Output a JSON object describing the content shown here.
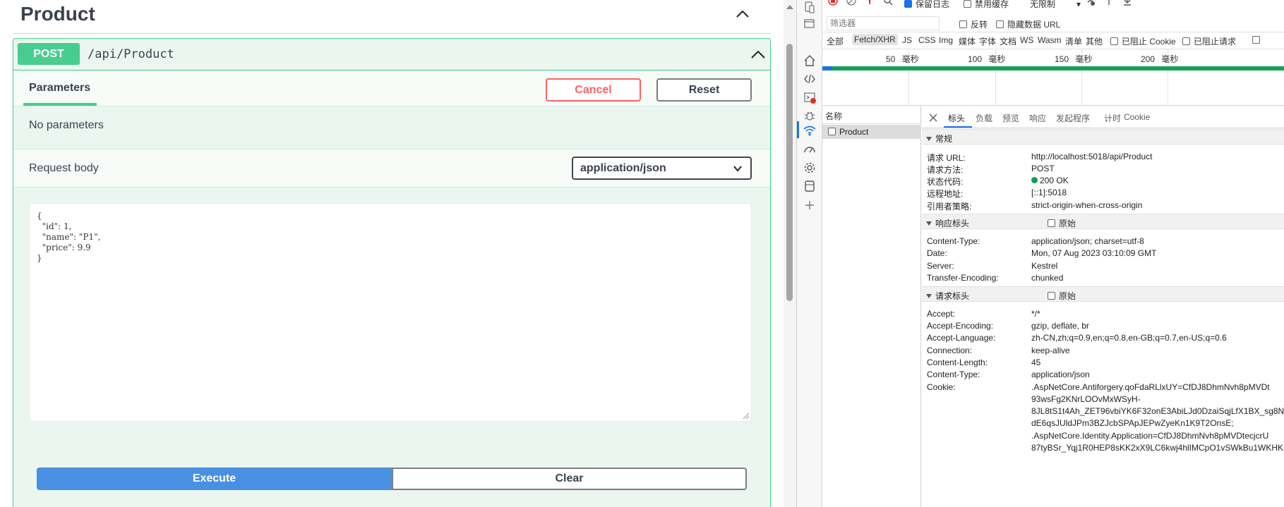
{
  "swagger": {
    "section_title": "Product",
    "operation": {
      "method": "POST",
      "path": "/api/Product"
    },
    "parameters_tab": "Parameters",
    "cancel_label": "Cancel",
    "reset_label": "Reset",
    "no_parameters": "No parameters",
    "request_body_label": "Request body",
    "content_type": "application/json",
    "body_lines": [
      "{",
      "  \"id\": 1,",
      "  \"name\": \"P1\",",
      "  \"price\": 9.9",
      "}"
    ],
    "execute_label": "Execute",
    "clear_label": "Clear"
  },
  "devtools": {
    "toolbar": {
      "preserve_log": "保留日志",
      "disable_cache": "禁用缓存",
      "throttle": "无限制"
    },
    "filter": {
      "placeholder": "筛选器",
      "invert": "反转",
      "hide_data_urls": "隐藏数据 URL"
    },
    "types": [
      "全部",
      "Fetch/XHR",
      "JS",
      "CSS",
      "Img",
      "媒体",
      "字体",
      "文档",
      "WS",
      "Wasm",
      "清单",
      "其他"
    ],
    "blocked_cookies": "已阻止 Cookie",
    "blocked_requests": "已阻止请求",
    "timeline": [
      {
        "value": "50",
        "unit": "毫秒"
      },
      {
        "value": "100",
        "unit": "毫秒"
      },
      {
        "value": "150",
        "unit": "毫秒"
      },
      {
        "value": "200",
        "unit": "毫秒"
      }
    ],
    "name_header": "名称",
    "request_name": "Product",
    "tabs": [
      "标头",
      "负载",
      "预览",
      "响应",
      "发起程序",
      "计时",
      "Cookie"
    ],
    "raw_label": "原始",
    "general": {
      "title": "常规",
      "rows": [
        {
          "k": "请求 URL:",
          "v": "http://localhost:5018/api/Product"
        },
        {
          "k": "请求方法:",
          "v": "POST"
        },
        {
          "k": "状态代码:",
          "v": "200 OK"
        },
        {
          "k": "远程地址:",
          "v": "[::1]:5018"
        },
        {
          "k": "引用者策略:",
          "v": "strict-origin-when-cross-origin"
        }
      ]
    },
    "response_headers": {
      "title": "响应标头",
      "rows": [
        {
          "k": "Content-Type:",
          "v": "application/json; charset=utf-8"
        },
        {
          "k": "Date:",
          "v": "Mon, 07 Aug 2023 03:10:09 GMT"
        },
        {
          "k": "Server:",
          "v": "Kestrel"
        },
        {
          "k": "Transfer-Encoding:",
          "v": "chunked"
        }
      ]
    },
    "request_headers": {
      "title": "请求标头",
      "rows": [
        {
          "k": "Accept:",
          "v": "*/*"
        },
        {
          "k": "Accept-Encoding:",
          "v": "gzip, deflate, br"
        },
        {
          "k": "Accept-Language:",
          "v": "zh-CN,zh;q=0.9,en;q=0.8,en-GB;q=0.7,en-US;q=0.6"
        },
        {
          "k": "Connection:",
          "v": "keep-alive"
        },
        {
          "k": "Content-Length:",
          "v": "45"
        },
        {
          "k": "Content-Type:",
          "v": "application/json"
        },
        {
          "k": "Cookie:",
          "v": ".AspNetCore.Antiforgery.qoFdaRLlxUY=CfDJ8DhmNvh8pMVDt"
        }
      ],
      "cookie_continuation": [
        "93wsFg2KNrLOOvMxWSyH-",
        "8JL8tS1t4Ah_ZET96vbiYK6F32onE3AbiLJd0DzaiSqjLfX1BX_sg8N",
        "dE6qsJUldJPm3BZJcbSPApJEPwZyeKn1K9T2OnsE;",
        ".AspNetCore.Identity.Application=CfDJ8DhmNvh8pMVDtecjcrU",
        "87tyBSr_Yqj1R0HEP8sKK2xX9LC6kwj4hlIMCpO1vSWkBu1WKHK"
      ]
    }
  }
}
